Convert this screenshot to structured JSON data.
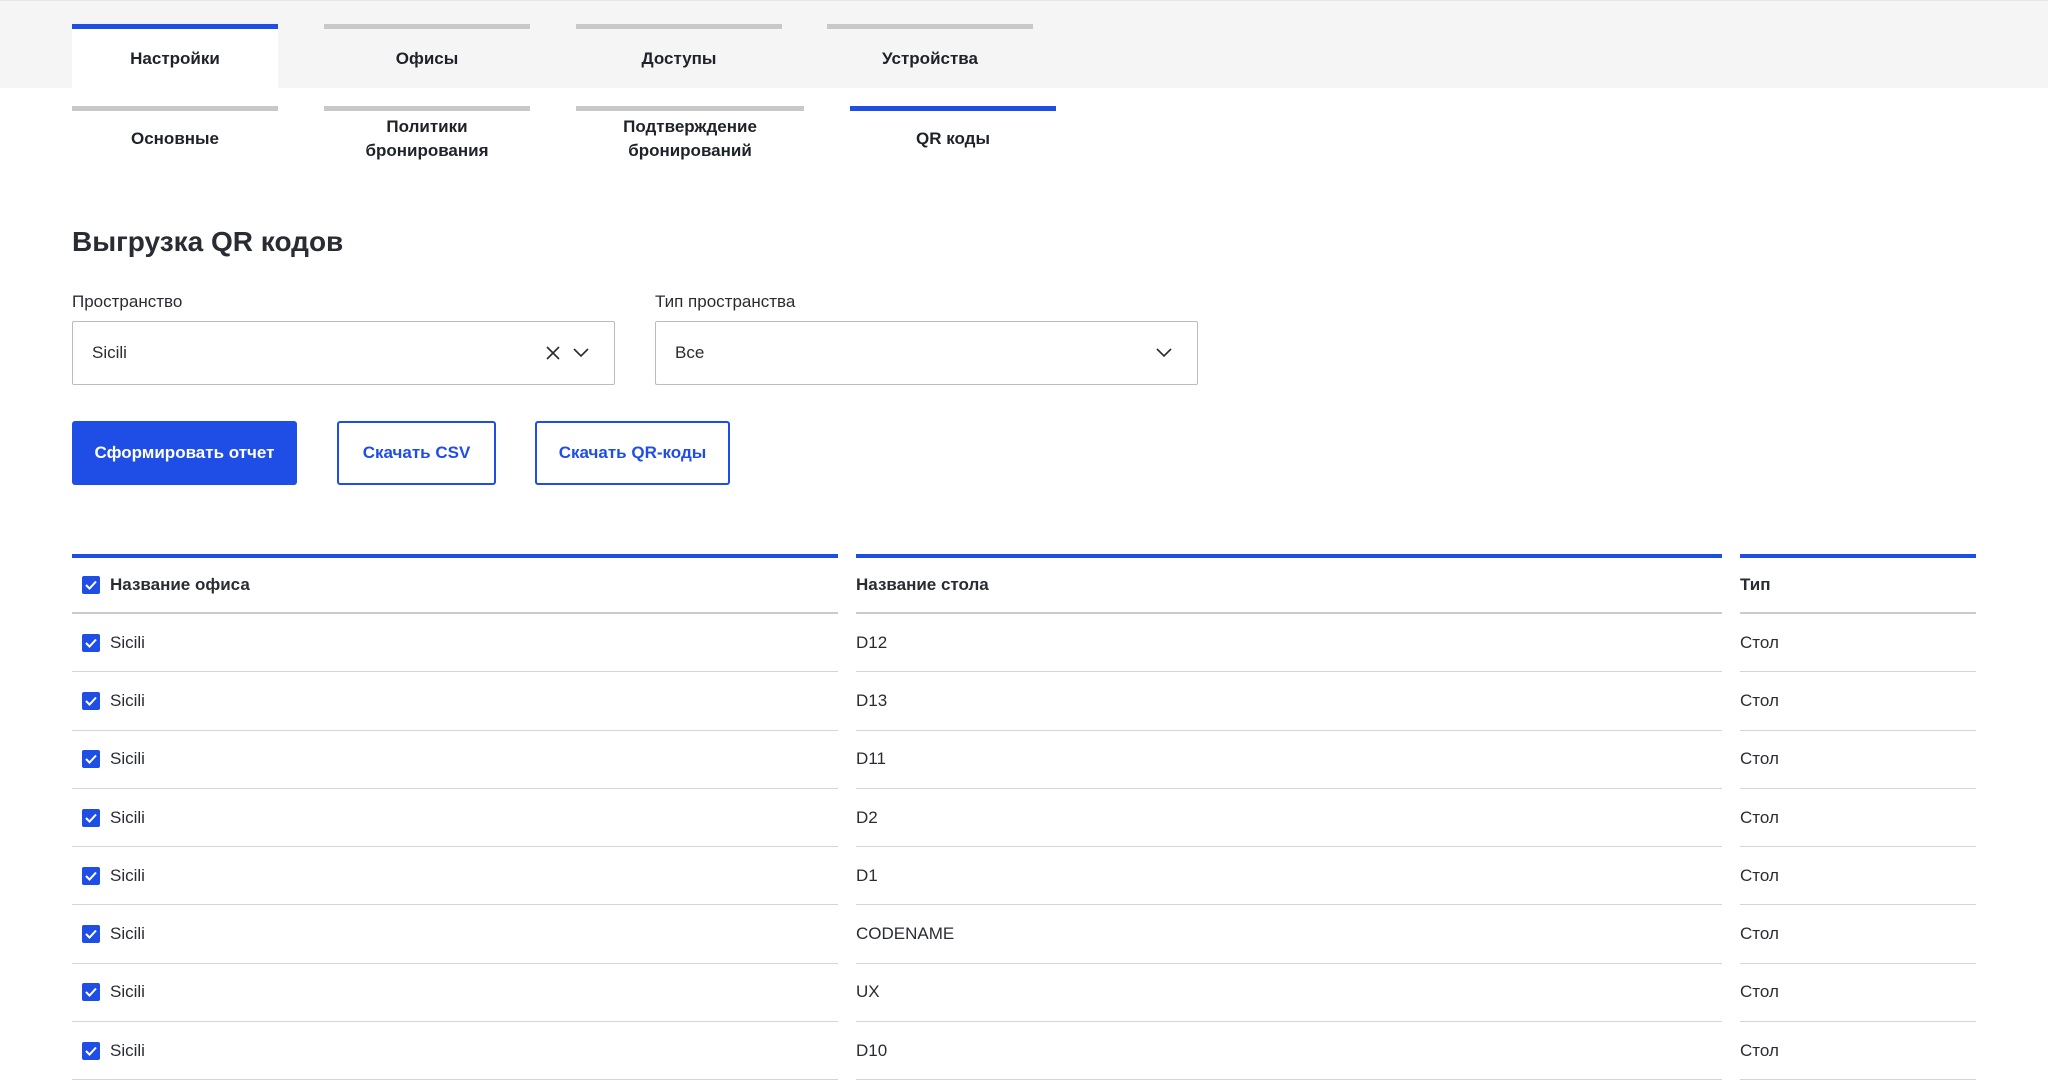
{
  "tabs": [
    {
      "label": "Настройки",
      "active": true
    },
    {
      "label": "Офисы",
      "active": false
    },
    {
      "label": "Доступы",
      "active": false
    },
    {
      "label": "Устройства",
      "active": false
    }
  ],
  "subtabs": [
    {
      "label": "Основные",
      "active": false
    },
    {
      "label": "Политики бронирования",
      "active": false
    },
    {
      "label": "Подтверждение бронирований",
      "active": false
    },
    {
      "label": "QR коды",
      "active": true
    }
  ],
  "page_title": "Выгрузка QR кодов",
  "filters": {
    "space": {
      "label": "Пространство",
      "value": "Sicili",
      "clear_icon": "close-icon",
      "dropdown_icon": "chevron-down-icon"
    },
    "space_type": {
      "label": "Тип пространства",
      "value": "Все",
      "dropdown_icon": "chevron-down-icon"
    }
  },
  "actions": {
    "generate": "Сформировать отчет",
    "download_csv": "Скачать CSV",
    "download_qr": "Скачать QR-коды"
  },
  "table": {
    "headers": {
      "office": "Название офиса",
      "desk": "Название стола",
      "type": "Тип"
    },
    "rows": [
      {
        "office": "Sicili",
        "desk": "D12",
        "type": "Стол"
      },
      {
        "office": "Sicili",
        "desk": "D13",
        "type": "Стол"
      },
      {
        "office": "Sicili",
        "desk": "D11",
        "type": "Стол"
      },
      {
        "office": "Sicili",
        "desk": "D2",
        "type": "Стол"
      },
      {
        "office": "Sicili",
        "desk": "D1",
        "type": "Стол"
      },
      {
        "office": "Sicili",
        "desk": "CODENAME",
        "type": "Стол"
      },
      {
        "office": "Sicili",
        "desk": "UX",
        "type": "Стол"
      },
      {
        "office": "Sicili",
        "desk": "D10",
        "type": "Стол"
      }
    ]
  },
  "colors": {
    "accent": "#1f4ee6",
    "tab_inactive": "#c8c8c8",
    "topbar_bg": "#f5f5f5"
  }
}
